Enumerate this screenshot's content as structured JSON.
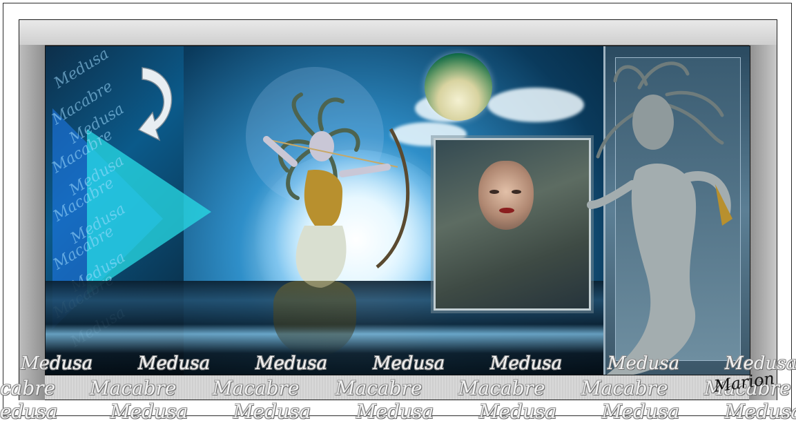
{
  "artwork": {
    "left_panel_watermark": [
      "Medusa",
      "Macabre"
    ],
    "bottom_watermark": {
      "row1": [
        "Medusa",
        "Medusa",
        "Medusa",
        "Medusa",
        "Medusa",
        "Medusa",
        "Medusa"
      ],
      "row2": [
        "cabre",
        "Macabre",
        "Macabre",
        "Macabre",
        "Macabre",
        "Macabre",
        "Macabre"
      ],
      "row3": [
        "edusa",
        "Medusa",
        "Medusa",
        "Medusa",
        "Medusa",
        "Medusa",
        "Medusa"
      ]
    },
    "signature": "Marion"
  },
  "colors": {
    "frame_gray": "#cfcfcf",
    "scene_dark": "#0a3a5c",
    "accent_cyan": "#28dce6",
    "planet_green": "#0f6a46"
  },
  "icons": {
    "curved_arrow": "curved-arrow-icon"
  }
}
